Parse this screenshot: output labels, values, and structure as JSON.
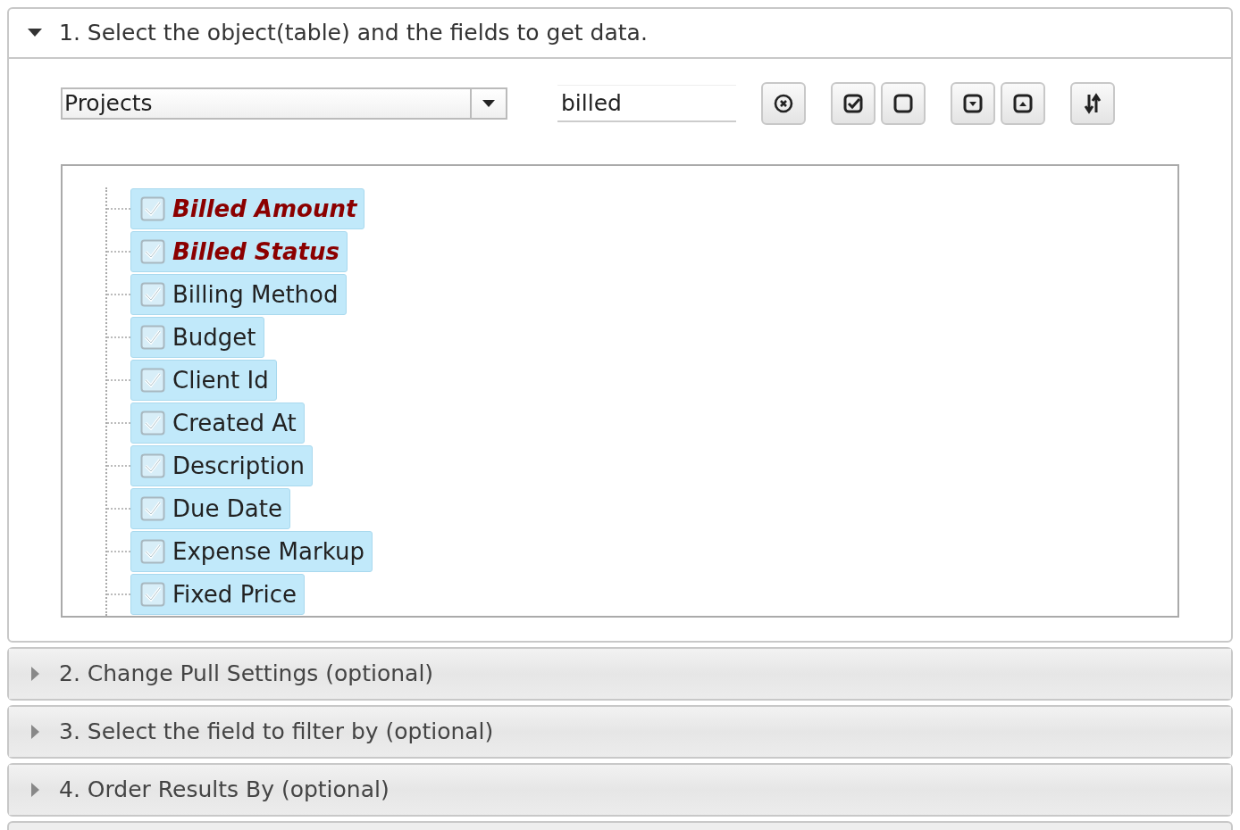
{
  "sections": [
    {
      "title": "1. Select the object(table) and the fields to get data.",
      "expanded": true
    },
    {
      "title": "2. Change Pull Settings (optional)",
      "expanded": false
    },
    {
      "title": "3. Select the field to filter by (optional)",
      "expanded": false
    },
    {
      "title": "4. Order Results By (optional)",
      "expanded": false
    }
  ],
  "object_select": {
    "value": "Projects"
  },
  "search": {
    "value": "billed"
  },
  "fields": [
    {
      "label": "Billed Amount",
      "checked": true,
      "match": true
    },
    {
      "label": "Billed Status",
      "checked": true,
      "match": true
    },
    {
      "label": "Billing Method",
      "checked": true,
      "match": false
    },
    {
      "label": "Budget",
      "checked": true,
      "match": false
    },
    {
      "label": "Client Id",
      "checked": true,
      "match": false
    },
    {
      "label": "Created At",
      "checked": true,
      "match": false
    },
    {
      "label": "Description",
      "checked": true,
      "match": false
    },
    {
      "label": "Due Date",
      "checked": true,
      "match": false
    },
    {
      "label": "Expense Markup",
      "checked": true,
      "match": false
    },
    {
      "label": "Fixed Price",
      "checked": true,
      "match": false
    }
  ]
}
